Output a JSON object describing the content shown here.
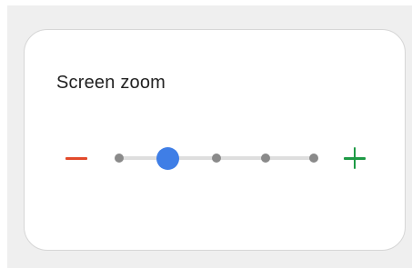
{
  "zoom_card": {
    "title": "Screen zoom",
    "decrease_icon": "minus-icon",
    "increase_icon": "plus-icon",
    "slider": {
      "steps": 5,
      "selected_index": 1
    }
  },
  "colors": {
    "decrease": "#e24a2b",
    "increase": "#1e9a45",
    "thumb": "#3f7ee6",
    "track": "#dedede",
    "tick": "#8a8a8a"
  }
}
